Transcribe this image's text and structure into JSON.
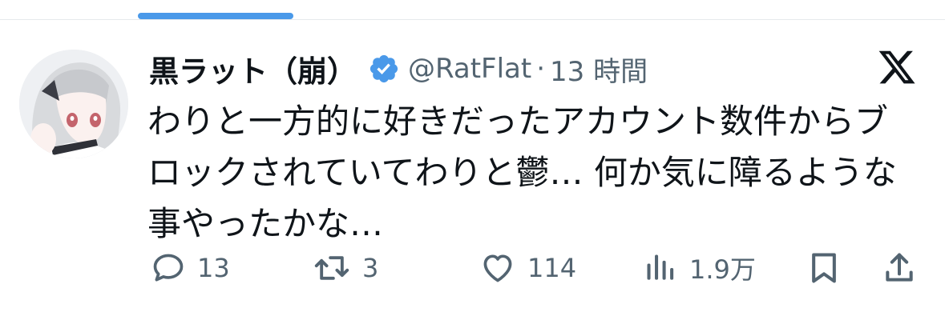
{
  "user": {
    "display_name": "黒ラット（崩）",
    "handle": "@RatFlat",
    "separator": "·",
    "time": "13 時間",
    "verified": true,
    "verified_color": "#4a99e9"
  },
  "tweet": {
    "lines": [
      "わりと一方的に好きだったアカウント数件からブ",
      "ロックされていてわりと鬱…  何か気に障るような",
      "事やったかな…"
    ]
  },
  "actions": {
    "reply_count": "13",
    "retweet_count": "3",
    "like_count": "114",
    "views_count": "1.9万"
  },
  "icons": {
    "platform": "x-logo-icon",
    "reply": "reply-icon",
    "retweet": "retweet-icon",
    "like": "heart-icon",
    "views": "views-icon",
    "bookmark": "bookmark-icon",
    "share": "share-icon"
  },
  "colors": {
    "text": "#0f1419",
    "secondary": "#536471",
    "accent": "#4a99e9"
  }
}
